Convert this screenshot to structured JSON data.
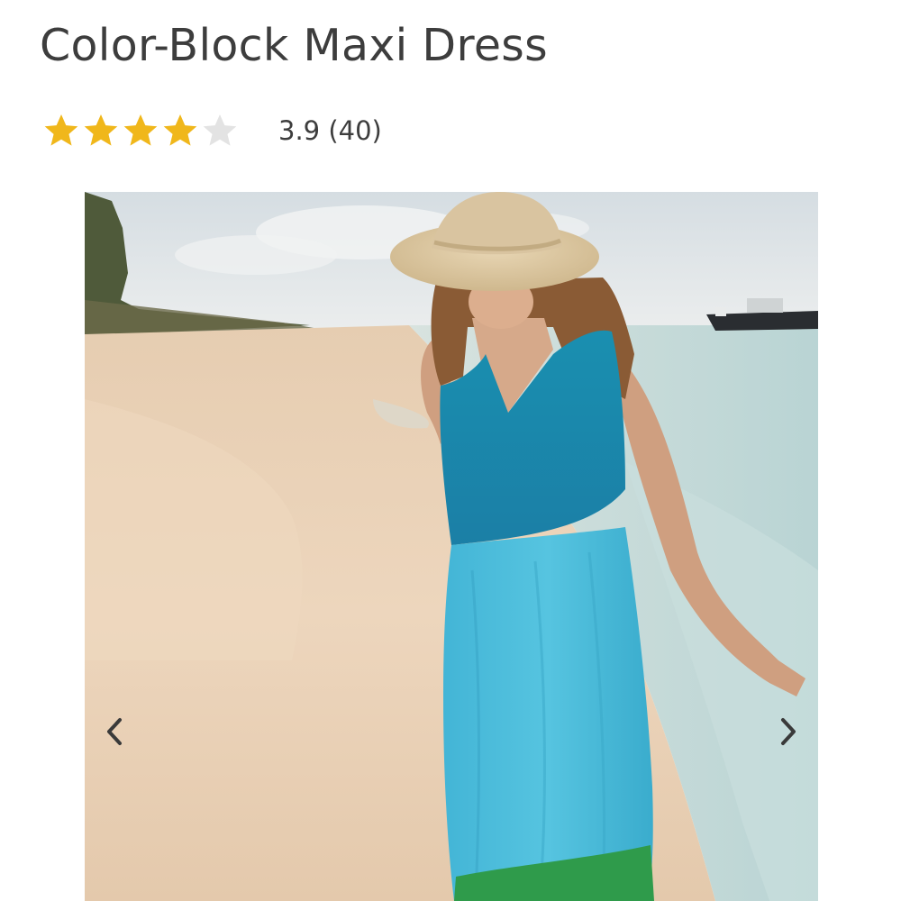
{
  "product": {
    "title": "Color-Block Maxi Dress",
    "rating": {
      "value": 3.9,
      "max": 5,
      "text": "3.9 (40)",
      "filled_color": "#f0b71b",
      "empty_color": "#e3e3e3"
    }
  },
  "gallery": {
    "image_alt": "Model in a color-block maxi dress and straw hat walking on a beach",
    "prev_icon": "chevron-left-icon",
    "next_icon": "chevron-right-icon",
    "arrow_color": "#3a3a3a"
  }
}
